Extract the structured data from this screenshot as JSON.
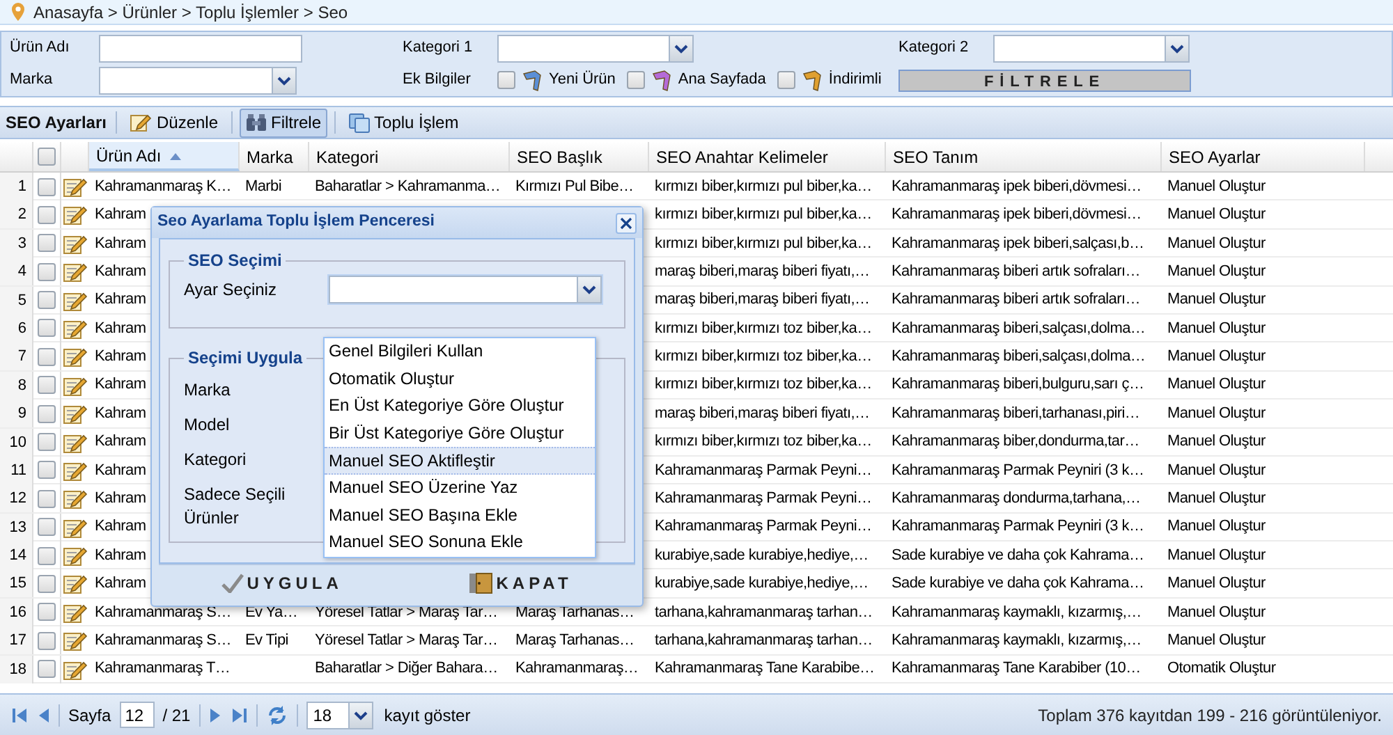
{
  "breadcrumb": "Anasayfa > Ürünler > Toplu İşlemler > Seo",
  "filters": {
    "fields": [
      {
        "label": "Ürün Adı",
        "kind": "text"
      },
      {
        "label": "Kategori 1",
        "kind": "select"
      },
      {
        "label": "Kategori 2",
        "kind": "select"
      },
      {
        "label": "Marka",
        "kind": "select"
      }
    ],
    "ek_bilgiler": {
      "label": "Ek Bilgiler",
      "options": [
        {
          "label": "Yeni Ürün",
          "checked": false,
          "color": "#5b8fd6"
        },
        {
          "label": "Ana Sayfada",
          "checked": false,
          "color": "#b56ad8"
        },
        {
          "label": "İndirimli",
          "checked": false,
          "color": "#e0a030"
        }
      ]
    },
    "button": "FİLTRELE"
  },
  "toolbar": {
    "title": "SEO Ayarları",
    "buttons": [
      {
        "label": "Düzenle",
        "kind": "edit",
        "selected": false
      },
      {
        "label": "Filtrele",
        "kind": "filter",
        "selected": true
      },
      {
        "label": "Toplu İşlem",
        "kind": "batch",
        "selected": false
      }
    ]
  },
  "table": {
    "header_checked": false,
    "columns": [
      {
        "label": "Ürün Adı",
        "sorted": true
      },
      {
        "label": "Marka",
        "sorted": false
      },
      {
        "label": "Kategori",
        "sorted": false
      },
      {
        "label": "SEO Başlık",
        "sorted": false
      },
      {
        "label": "SEO Anahtar Kelimeler",
        "sorted": false
      },
      {
        "label": "SEO Tanım",
        "sorted": false
      },
      {
        "label": "SEO Ayarlar",
        "sorted": false
      }
    ],
    "rows": [
      {
        "no": "1",
        "checked": false,
        "urun": "Kahramanmaraş K…",
        "marka": "Marbi",
        "kategori": "Baharatlar > Kahramanma…",
        "baslik": "Kırmızı Pul Bibe…",
        "anahtar": "kırmızı biber,kırmızı pul biber,ka…",
        "tanim": "Kahramanmaraş ipek biberi,dövmesi…",
        "ayar": "Manuel Oluştur"
      },
      {
        "no": "2",
        "checked": false,
        "urun": "Kahram",
        "anahtar": "kırmızı biber,kırmızı pul biber,ka…",
        "tanim": "Kahramanmaraş ipek biberi,dövmesi…",
        "ayar": "Manuel Oluştur"
      },
      {
        "no": "3",
        "checked": false,
        "urun": "Kahram",
        "anahtar": "kırmızı biber,kırmızı pul biber,ka…",
        "tanim": "Kahramanmaraş ipek biberi,salçası,b…",
        "ayar": "Manuel Oluştur"
      },
      {
        "no": "4",
        "checked": false,
        "urun": "Kahram",
        "anahtar": "maraş biberi,maraş biberi fiyatı,…",
        "tanim": "Kahramanmaraş biberi artık sofraları…",
        "ayar": "Manuel Oluştur"
      },
      {
        "no": "5",
        "checked": false,
        "urun": "Kahram",
        "anahtar": "maraş biberi,maraş biberi fiyatı,…",
        "tanim": "Kahramanmaraş biberi artık sofraları…",
        "ayar": "Manuel Oluştur"
      },
      {
        "no": "6",
        "checked": false,
        "urun": "Kahram",
        "anahtar": "kırmızı biber,kırmızı toz biber,ka…",
        "tanim": "Kahramanmaraş biberi,salçası,dolma…",
        "ayar": "Manuel Oluştur"
      },
      {
        "no": "7",
        "checked": false,
        "urun": "Kahram",
        "anahtar": "kırmızı biber,kırmızı toz biber,ka…",
        "tanim": "Kahramanmaraş biberi,salçası,dolma…",
        "ayar": "Manuel Oluştur"
      },
      {
        "no": "8",
        "checked": false,
        "urun": "Kahram",
        "anahtar": "kırmızı biber,kırmızı toz biber,ka…",
        "tanim": "Kahramanmaraş biberi,bulguru,sarı ç…",
        "ayar": "Manuel Oluştur"
      },
      {
        "no": "9",
        "checked": false,
        "urun": "Kahram",
        "anahtar": "maraş biberi,maraş biberi fiyatı,…",
        "tanim": "Kahramanmaraş biberi,tarhanası,piri…",
        "ayar": "Manuel Oluştur"
      },
      {
        "no": "10",
        "checked": false,
        "urun": "Kahram",
        "anahtar": "kırmızı biber,kırmızı toz biber,ka…",
        "tanim": "Kahramanmaraş biber,dondurma,tar…",
        "ayar": "Manuel Oluştur"
      },
      {
        "no": "11",
        "checked": false,
        "urun": "Kahram",
        "anahtar": "Kahramanmaraş Parmak Peyni…",
        "tanim": "Kahramanmaraş Parmak Peyniri (3 k…",
        "ayar": "Manuel Oluştur"
      },
      {
        "no": "12",
        "checked": false,
        "urun": "Kahram",
        "anahtar": "Kahramanmaraş Parmak Peyni…",
        "tanim": "Kahramanmaraş dondurma,tarhana,…",
        "ayar": "Manuel Oluştur"
      },
      {
        "no": "13",
        "checked": false,
        "urun": "Kahram",
        "anahtar": "Kahramanmaraş Parmak Peyni…",
        "tanim": "Kahramanmaraş Parmak Peyniri (3 k…",
        "ayar": "Manuel Oluştur"
      },
      {
        "no": "14",
        "checked": false,
        "urun": "Kahram",
        "anahtar": "kurabiye,sade kurabiye,hediye,…",
        "tanim": "Sade kurabiye ve daha çok Kahrama…",
        "ayar": "Manuel Oluştur"
      },
      {
        "no": "15",
        "checked": false,
        "urun": "Kahram",
        "anahtar": "kurabiye,sade kurabiye,hediye,…",
        "tanim": "Sade kurabiye ve daha çok Kahrama…",
        "ayar": "Manuel Oluştur"
      },
      {
        "no": "16",
        "checked": false,
        "urun": "Kahramanmaraş S…",
        "marka": "Ev Ya…",
        "kategori": "Yöresel Tatlar > Maraş Tar…",
        "baslik": "Maraş Tarhanas…",
        "anahtar": "tarhana,kahramanmaraş tarhan…",
        "tanim": "Kahramanmaraş kaymaklı, kızarmış,…",
        "ayar": "Manuel Oluştur"
      },
      {
        "no": "17",
        "checked": false,
        "urun": "Kahramanmaraş S…",
        "marka": "Ev Tipi",
        "kategori": "Yöresel Tatlar > Maraş Tar…",
        "baslik": "Maraş Tarhanas…",
        "anahtar": "tarhana,kahramanmaraş tarhan…",
        "tanim": "Kahramanmaraş kaymaklı, kızarmış,…",
        "ayar": "Manuel Oluştur"
      },
      {
        "no": "18",
        "checked": false,
        "urun": "Kahramanmaraş T…",
        "kategori": "Baharatlar > Diğer Bahara…",
        "baslik": "Kahramanmaraş…",
        "anahtar": "Kahramanmaraş Tane Karabibe…",
        "tanim": "Kahramanmaraş Tane Karabiber (10…",
        "ayar": "Otomatik Oluştur"
      }
    ]
  },
  "pager": {
    "page_label": "Sayfa",
    "page": "12",
    "total_pages": "/ 21",
    "page_size": "18",
    "page_size_label": "kayıt göster",
    "summary": "Toplam 376 kayıtdan 199 - 216 görüntüleniyor."
  },
  "dialog": {
    "title": "Seo Ayarlama Toplu İşlem Penceresi",
    "seo_secimi": {
      "legend": "SEO Seçimi",
      "label": "Ayar Seçiniz",
      "expanded": true,
      "options": [
        {
          "label": "Genel Bilgileri Kullan",
          "selected": false
        },
        {
          "label": "Otomatik Oluştur",
          "selected": false
        },
        {
          "label": "En Üst Kategoriye Göre Oluştur",
          "selected": false
        },
        {
          "label": "Bir Üst Kategoriye Göre Oluştur",
          "selected": false
        },
        {
          "label": "Manuel SEO Aktifleştir",
          "selected": true
        },
        {
          "label": "Manuel SEO Üzerine Yaz",
          "selected": false
        },
        {
          "label": "Manuel SEO Başına Ekle",
          "selected": false
        },
        {
          "label": "Manuel SEO Sonuna Ekle",
          "selected": false
        }
      ]
    },
    "secimi_uygula": {
      "legend": "Seçimi Uygula",
      "labels": [
        "Marka",
        "Model",
        "Kategori",
        "Sadece Seçili Ürünler"
      ]
    },
    "buttons": [
      {
        "label": "UYGULA",
        "kind": "apply"
      },
      {
        "label": "KAPAT",
        "kind": "close"
      }
    ]
  }
}
